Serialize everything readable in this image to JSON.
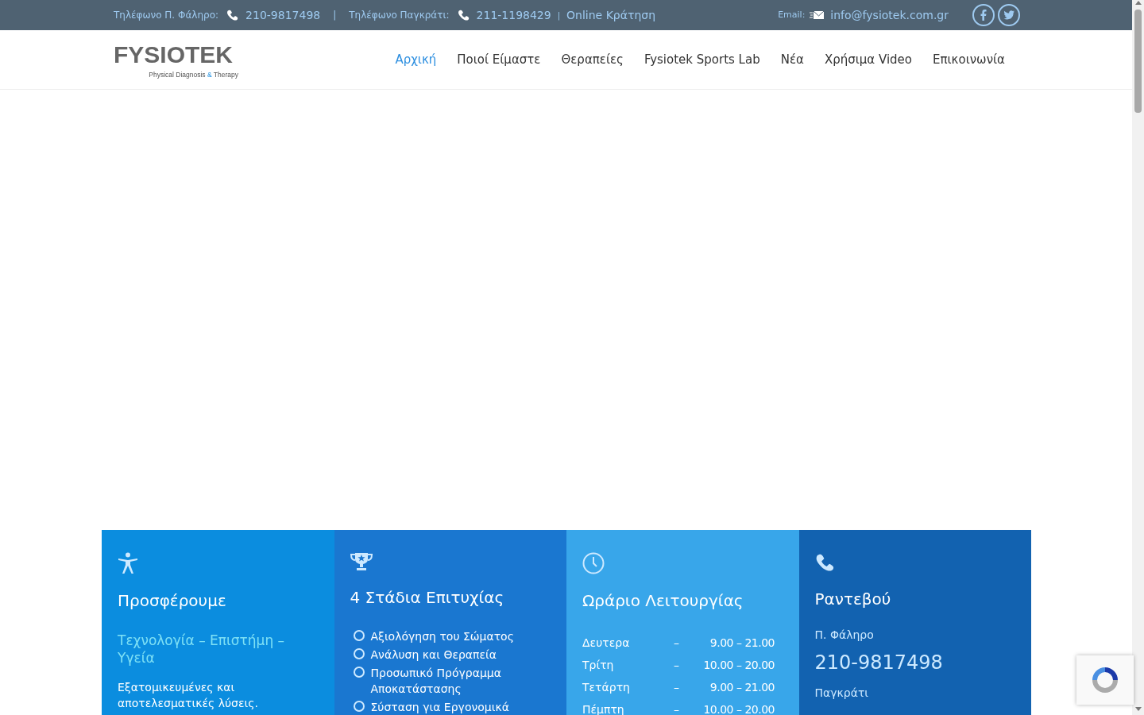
{
  "top_bar": {
    "phone_faliro_label": "Τηλέφωνο Π. Φάληρο:",
    "phone_faliro": "210-9817498",
    "separator": "|",
    "phone_pagkrati_label": "Τηλέφωνο Παγκράτι:",
    "phone_pagkrati": "211-1198429",
    "separator_2": "|",
    "booking_link": "Online Κράτηση",
    "email_label": "Email:",
    "email": "info@fysiotek.com.gr"
  },
  "logo": {
    "wordmark": "FYSIOTEK",
    "tagline": "Physical Diagnosis **&** Therapy"
  },
  "nav": [
    {
      "label": "Αρχική",
      "selected": true
    },
    {
      "label": "Ποιοί Είμαστε",
      "selected": false
    },
    {
      "label": "Θεραπείες",
      "selected": false
    },
    {
      "label": "Fysiotek Sports Lab",
      "selected": false
    },
    {
      "label": "Νέα",
      "selected": false
    },
    {
      "label": "Χρήσιμα Video",
      "selected": false
    },
    {
      "label": "Επικοινωνία",
      "selected": false
    }
  ],
  "cards": [
    {
      "kind": "offer",
      "color": "#0b8ddf",
      "title": "Προσφέρουμε",
      "subtitle": "Τεχνολογία – Επιστήμη – Υγεία",
      "text": "Εξατομικευμένες και αποτελεσματικές λύσεις."
    },
    {
      "kind": "stages",
      "color": "#1a77d0",
      "title": "4 Στάδια Επιτυχίας",
      "items": [
        "Αξιολόγηση του Σώματος",
        "Ανάλυση και Θεραπεία",
        "Προσωπικό Πρόγραμμα Αποκατάστασης",
        "Σύσταση για Εργονομικά"
      ]
    },
    {
      "kind": "hours",
      "color": "#38a6ea",
      "title": "Ωράριο Λειτουργίας",
      "rows": [
        {
          "day": "Δευτερα",
          "separator": "–",
          "hours": "9.00 – 21.00"
        },
        {
          "day": "Τρίτη",
          "separator": "–",
          "hours": "10.00 – 20.00"
        },
        {
          "day": "Τετάρτη",
          "separator": "–",
          "hours": "9.00 – 21.00"
        },
        {
          "day": "Πέμπτη",
          "separator": "–",
          "hours": "10.00 – 20.00"
        }
      ]
    },
    {
      "kind": "contact",
      "color": "#1262b0",
      "title": "Ραντεβού",
      "locations": [
        {
          "name": "Π. Φάληρο",
          "phone": "210-9817498"
        },
        {
          "name": "Παγκράτι"
        }
      ]
    }
  ]
}
